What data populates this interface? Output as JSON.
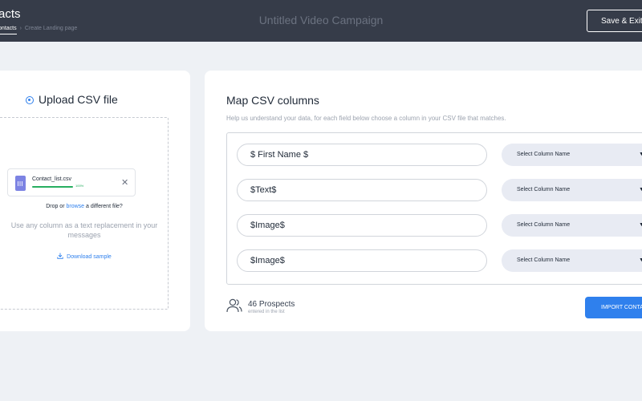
{
  "header": {
    "page_title": "acts",
    "breadcrumbs": [
      "ontacts",
      "Create Landing page"
    ],
    "breadcrumb_separator": "›",
    "campaign_title": "Untitled Video Campaign",
    "save_exit_label": "Save & Exit"
  },
  "upload": {
    "title": "Upload CSV file",
    "file": {
      "name": "Contact_list.csv",
      "progress_percent": 100,
      "progress_label": "100%"
    },
    "drop_prefix": "Drop or",
    "browse_link": "browse",
    "drop_suffix": "a different file?",
    "hint": "Use any column as a text replacement in your messages",
    "download_label": "Download sample"
  },
  "mapping": {
    "title": "Map CSV columns",
    "description": "Help us understand your data, for each field below choose a column in your CSV file that matches.",
    "rows": [
      {
        "field": "$ First Name $",
        "select": "Select Column Name"
      },
      {
        "field": "$Text$",
        "select": "Select Column Name"
      },
      {
        "field": "$Image$",
        "select": "Select Column Name"
      },
      {
        "field": "$Image$",
        "select": "Select Column Name"
      }
    ]
  },
  "footer": {
    "prospects_count": "46 Prospects",
    "prospects_sub": "entered in the list",
    "import_label": "IMPORT CONTACTS"
  },
  "icons": {
    "radio": "radio-selected-icon",
    "file": "file-icon",
    "close": "close-icon",
    "download": "download-icon",
    "people": "people-icon",
    "caret": "caret-down-icon"
  },
  "colors": {
    "header_bg": "#363c49",
    "page_bg": "#eef1f5",
    "accent": "#2f80ed",
    "progress": "#27ae60",
    "select_bg": "#e8ebf3"
  }
}
